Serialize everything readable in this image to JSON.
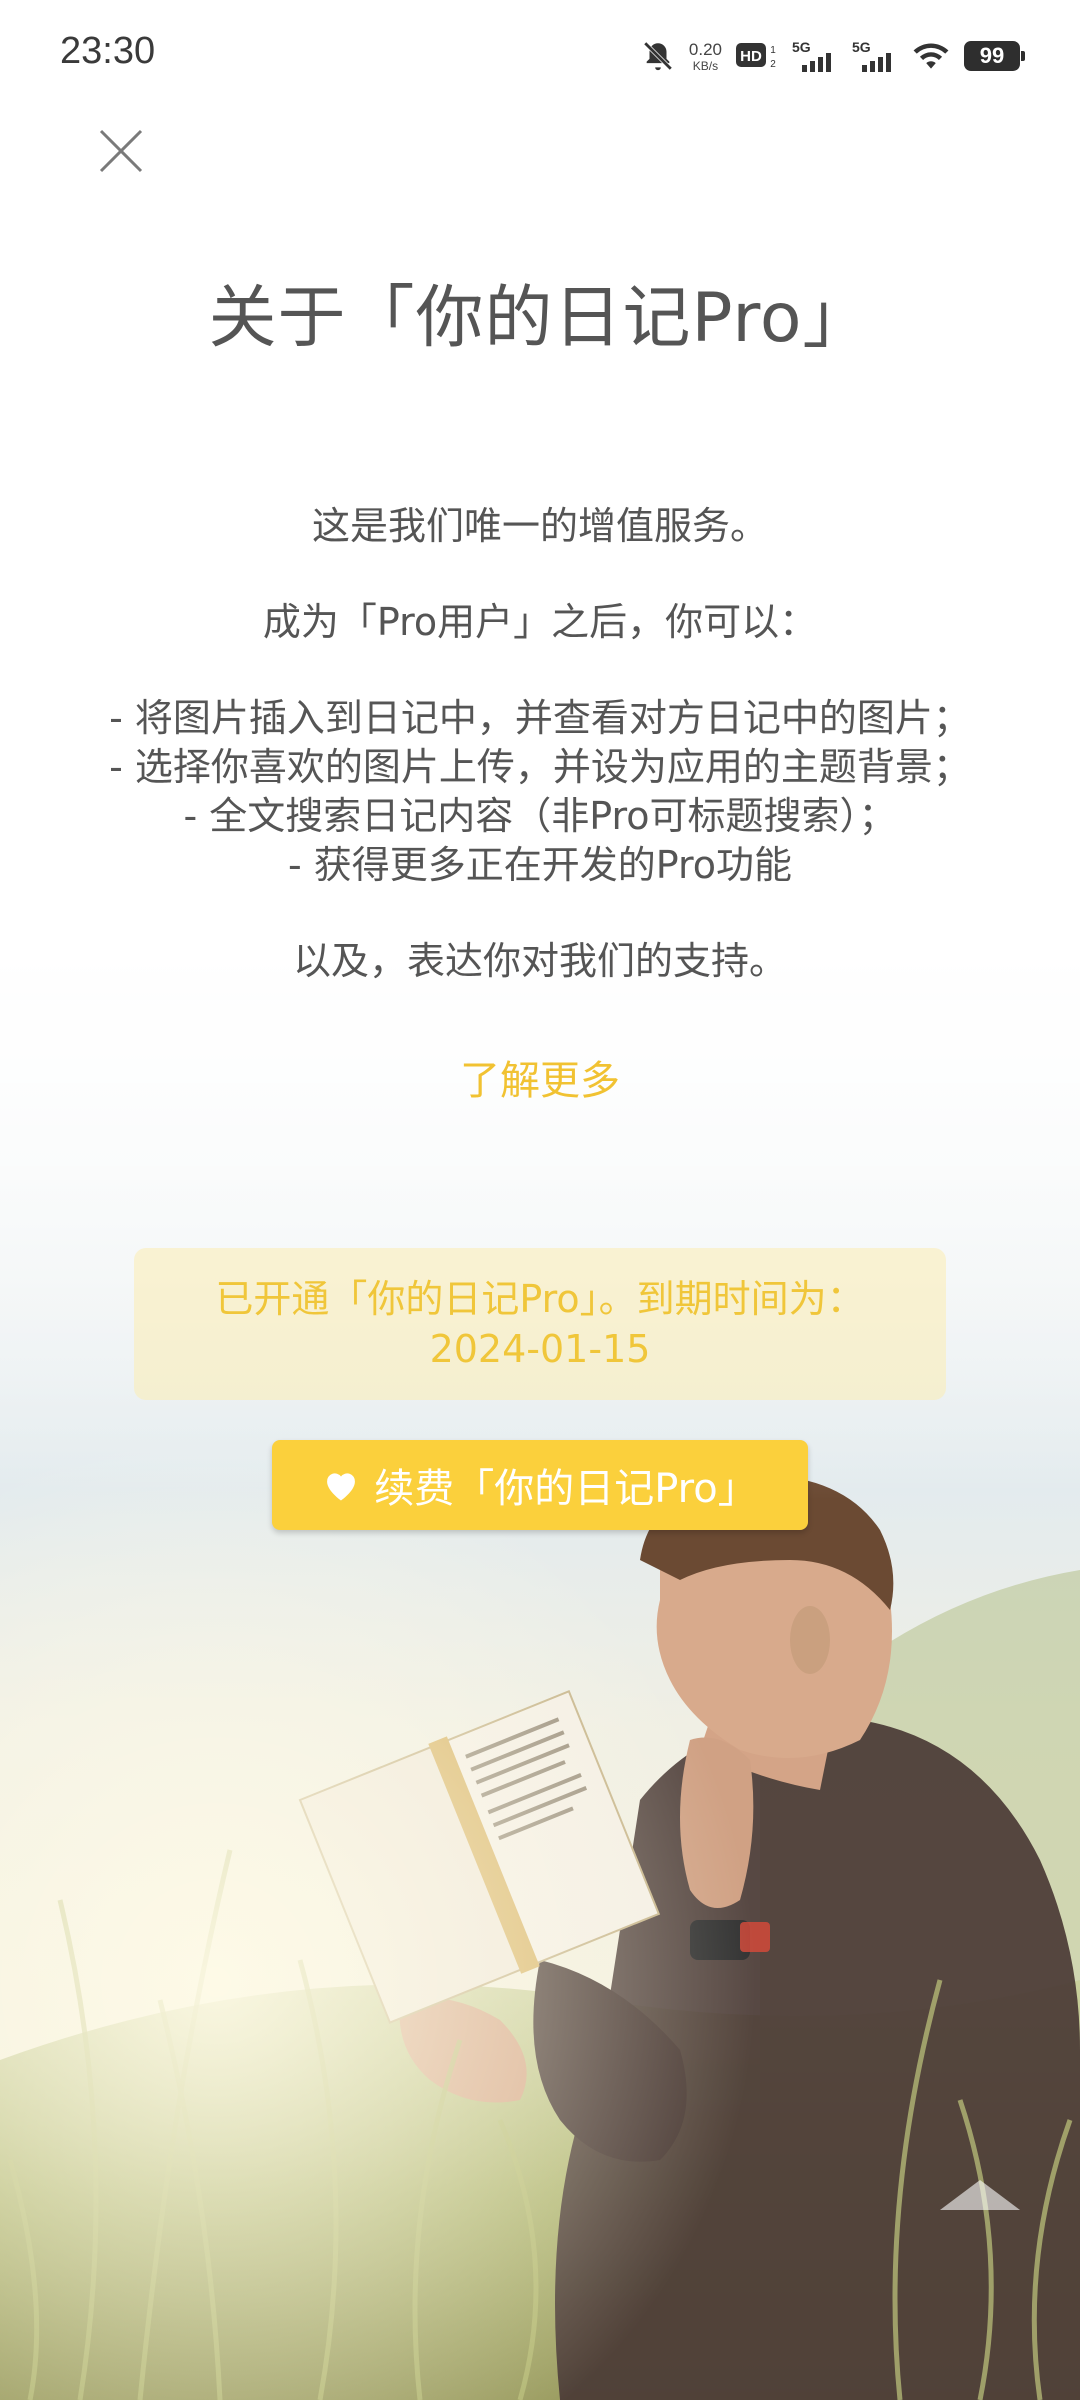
{
  "status_bar": {
    "time": "23:30",
    "net_speed_value": "0.20",
    "net_speed_unit": "KB/s",
    "hd_label": "HD",
    "sim1_label": "5G",
    "sim2_label": "5G",
    "battery_level": "99",
    "icons": [
      "mute-bell-icon",
      "hd-icon",
      "signal-5g-icon",
      "signal-5g-icon",
      "wifi-icon",
      "battery-icon"
    ]
  },
  "header": {
    "close_icon": "close-icon",
    "title": "关于「你的日记Pro」"
  },
  "description": {
    "intro": "这是我们唯一的增值服务。",
    "after_pro": "成为「Pro用户」之后，你可以：",
    "features": [
      "- 将图片插入到日记中，并查看对方日记中的图片；",
      "- 选择你喜欢的图片上传，并设为应用的主题背景；",
      "- 全文搜索日记内容（非Pro可标题搜索）；",
      "- 获得更多正在开发的Pro功能"
    ],
    "closing": "以及，表达你对我们的支持。"
  },
  "learn_more": "了解更多",
  "subscription": {
    "status_text": "已开通「你的日记Pro」。到期时间为：",
    "expiry_date": "2024-01-15"
  },
  "renew_button": {
    "label": "续费「你的日记Pro」",
    "icon": "heart-icon"
  },
  "colors": {
    "accent": "#fbd03c",
    "accent_text": "#f1c232",
    "body_text": "#555555"
  }
}
